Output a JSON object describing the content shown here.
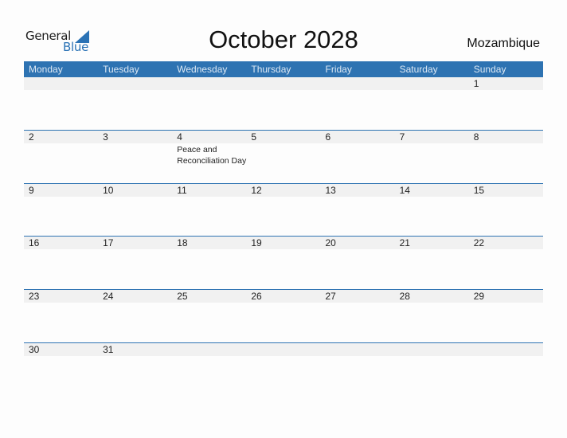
{
  "logo": {
    "word1": "General",
    "word2": "Blue",
    "icon": "blue-triangle-flag-icon"
  },
  "title": "October 2028",
  "country": "Mozambique",
  "weekdays": [
    "Monday",
    "Tuesday",
    "Wednesday",
    "Thursday",
    "Friday",
    "Saturday",
    "Sunday"
  ],
  "weeks": [
    {
      "days": [
        "",
        "",
        "",
        "",
        "",
        "",
        "1"
      ],
      "events": [
        "",
        "",
        "",
        "",
        "",
        "",
        ""
      ]
    },
    {
      "days": [
        "2",
        "3",
        "4",
        "5",
        "6",
        "7",
        "8"
      ],
      "events": [
        "",
        "",
        "Peace and Reconciliation Day",
        "",
        "",
        "",
        ""
      ]
    },
    {
      "days": [
        "9",
        "10",
        "11",
        "12",
        "13",
        "14",
        "15"
      ],
      "events": [
        "",
        "",
        "",
        "",
        "",
        "",
        ""
      ]
    },
    {
      "days": [
        "16",
        "17",
        "18",
        "19",
        "20",
        "21",
        "22"
      ],
      "events": [
        "",
        "",
        "",
        "",
        "",
        "",
        ""
      ]
    },
    {
      "days": [
        "23",
        "24",
        "25",
        "26",
        "27",
        "28",
        "29"
      ],
      "events": [
        "",
        "",
        "",
        "",
        "",
        "",
        ""
      ]
    },
    {
      "days": [
        "30",
        "31",
        "",
        "",
        "",
        "",
        ""
      ],
      "events": [
        "",
        "",
        "",
        "",
        "",
        "",
        ""
      ]
    }
  ],
  "colors": {
    "accent": "#2e73b2",
    "strip": "#f1f1f1"
  }
}
